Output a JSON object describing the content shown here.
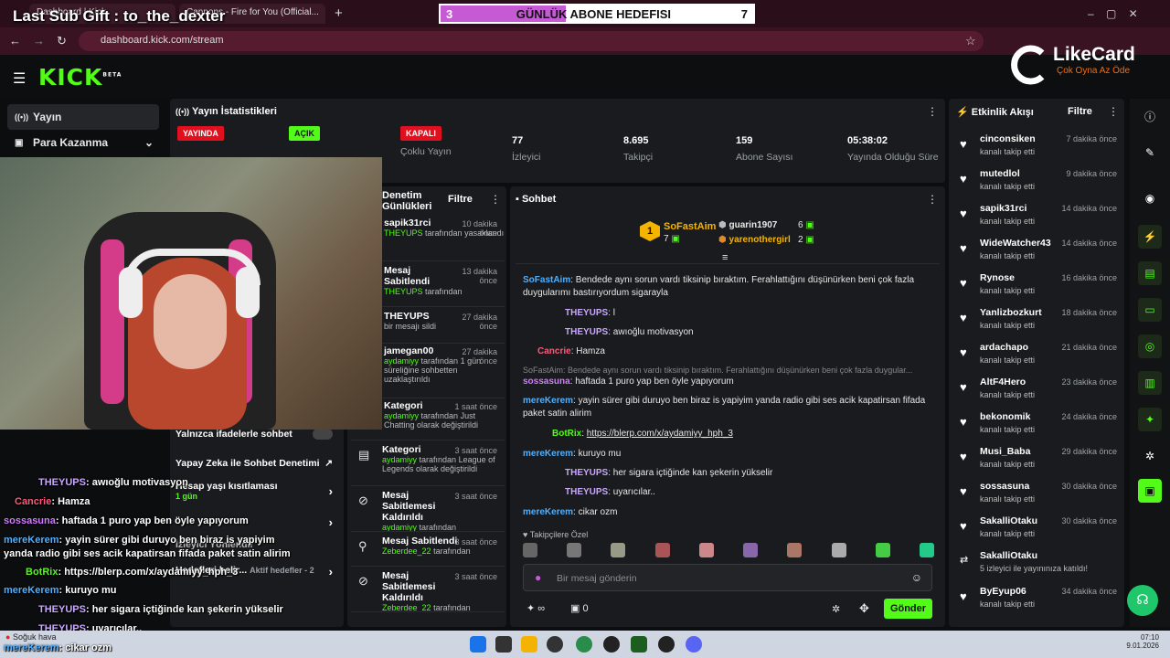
{
  "browser": {
    "tabs": [
      "Dashboard | Kick",
      "Kick Dashboard",
      "Cannons - Fire for You (Official..."
    ],
    "url": "dashboard.kick.com/stream"
  },
  "overlay": {
    "title": "Last Sub Gift : to_the_dexter",
    "goal": {
      "current": "3",
      "label": "GÜNLÜK ABONE HEDEFISI",
      "target": "7",
      "progress": 0.43
    }
  },
  "likecard": {
    "brand": "LikeCard",
    "tagline": "Çok Oyna  Az Öde"
  },
  "kick": {
    "logo": "KICK",
    "logo_sup": "BETA"
  },
  "left_nav": {
    "items": [
      {
        "label": "Yayın"
      },
      {
        "label": "Para Kazanma"
      }
    ]
  },
  "stats": {
    "title": "Yayın İstatistikleri",
    "live_badge": "YAYINDA",
    "open_badge": "AÇIK",
    "closed_badge": "KAPALI",
    "multi_stream": "Çoklu Yayın",
    "cells": [
      {
        "value": "77",
        "label": "İzleyici"
      },
      {
        "value": "8.695",
        "label": "Takipçi"
      },
      {
        "value": "159",
        "label": "Abone Sayısı"
      },
      {
        "value": "05:38:02",
        "label": "Yayında Olduğu Süre"
      }
    ]
  },
  "settings": {
    "rows": [
      {
        "label": "Yalnızca ifadelerle sohbet"
      },
      {
        "label": "Yapay Zeka ile Sohbet Denetimi"
      },
      {
        "label": "Hesap yaşı kısıtlaması",
        "sub": "1 gün"
      },
      {
        "label": "İzleyici Yönlendir"
      },
      {
        "label": "Hedefleri belir...",
        "sub": "Aktif hedefler - 2"
      }
    ]
  },
  "modlog": {
    "title": "Denetim Günlükleri",
    "filter": "Filtre",
    "items": [
      {
        "title": "sapik31rci",
        "time": "10 dakika önce",
        "by": "THEYUPS",
        "rest": "tarafından yasaklandı"
      },
      {
        "title": "Mesaj Sabitlendi",
        "time": "13 dakika önce",
        "by": "THEYUPS",
        "rest": "tarafından"
      },
      {
        "title": "THEYUPS",
        "time": "27 dakika önce",
        "by": "",
        "rest": "bir mesajı sildi"
      },
      {
        "title": "jamegan00",
        "time": "27 dakika önce",
        "by": "aydamiyy",
        "rest": "tarafından 1 gün süreliğine sohbetten uzaklaştırıldı"
      },
      {
        "title": "Kategori",
        "time": "1 saat önce",
        "by": "aydamiyy",
        "rest": "tarafından Just Chatting olarak değiştirildi"
      },
      {
        "title": "Kategori",
        "time": "3 saat önce",
        "by": "aydamiyy",
        "rest": "tarafından League of Legends olarak değiştirildi"
      },
      {
        "title": "Mesaj Sabitlemesi Kaldırıldı",
        "time": "3 saat önce",
        "by": "aydamiyy",
        "rest": "tarafından"
      },
      {
        "title": "Mesaj Sabitlendi",
        "time": "3 saat önce",
        "by": "Zeberdee_22",
        "rest": "tarafından"
      },
      {
        "title": "Mesaj Sabitlemesi Kaldırıldı",
        "time": "3 saat önce",
        "by": "Zeberdee_22",
        "rest": "tarafından"
      }
    ]
  },
  "chat": {
    "title": "Sohbet",
    "top_gifters": [
      {
        "rank": "1",
        "name": "SoFastAim",
        "count": "7"
      },
      {
        "rank": "2",
        "name": "guarin1907",
        "count": "6"
      },
      {
        "rank": "3",
        "name": "yarenothergirl",
        "count": "2"
      }
    ],
    "messages": [
      {
        "user": "SoFastAim",
        "color": "#4fb0ff",
        "text": "Bendede aynı sorun vardı tiksinip bıraktım. Ferahlattığını düşünürken beni çok fazla duygularımı bastırıyordum sigarayla"
      },
      {
        "user": "THEYUPS",
        "color": "#c9a6ff",
        "text": "l"
      },
      {
        "user": "THEYUPS",
        "color": "#c9a6ff",
        "text": "awıoğlu motivasyon"
      },
      {
        "user": "Cancrie",
        "color": "#ff5a7a",
        "text": "Hamza"
      },
      {
        "reply": "SoFastAim: Bendede aynı sorun vardı tiksinip bıraktım. Ferahlattığını düşünürken beni çok fazla duygular...",
        "user": "sossasuna",
        "color": "#d27cff",
        "text": "haftada 1 puro yap ben öyle yapıyorum"
      },
      {
        "user": "mereKerem",
        "color": "#4fb0ff",
        "text": "yayin sürer gibi duruyo ben biraz is yapiyim yanda radio gibi ses acik kapatirsan fifada paket satin alirim"
      },
      {
        "user": "BotRix",
        "color": "#53fc18",
        "text": "https://blerp.com/x/aydamiyy_hph_3"
      },
      {
        "user": "mereKerem",
        "color": "#4fb0ff",
        "text": "kuruyo mu"
      },
      {
        "user": "THEYUPS",
        "color": "#c9a6ff",
        "text": "her sigara içtiğinde kan şekerin yükselir"
      },
      {
        "user": "THEYUPS",
        "color": "#c9a6ff",
        "text": "uyarıcılar.."
      },
      {
        "user": "mereKerem",
        "color": "#4fb0ff",
        "text": "cikar ozm"
      }
    ],
    "followers_only": "Takipçilere Özel",
    "input_placeholder": "Bir mesaj gönderin",
    "points": "∞",
    "gifts": "0",
    "send": "Gönder"
  },
  "activity": {
    "title": "Etkinlik Akışı",
    "filter": "Filtre",
    "items": [
      {
        "name": "cinconsiken",
        "time": "7 dakika önce",
        "sub": "kanalı takip etti"
      },
      {
        "name": "mutedlol",
        "time": "9 dakika önce",
        "sub": "kanalı takip etti"
      },
      {
        "name": "sapik31rci",
        "time": "14 dakika önce",
        "sub": "kanalı takip etti"
      },
      {
        "name": "WideWatcher43",
        "time": "14 dakika önce",
        "sub": "kanalı takip etti"
      },
      {
        "name": "Rynose",
        "time": "16 dakika önce",
        "sub": "kanalı takip etti"
      },
      {
        "name": "Yanlizbozkurt",
        "time": "18 dakika önce",
        "sub": "kanalı takip etti"
      },
      {
        "name": "ardachapo",
        "time": "21 dakika önce",
        "sub": "kanalı takip etti"
      },
      {
        "name": "AltF4Hero",
        "time": "23 dakika önce",
        "sub": "kanalı takip etti"
      },
      {
        "name": "bekonomik",
        "time": "24 dakika önce",
        "sub": "kanalı takip etti"
      },
      {
        "name": "Musi_Baba",
        "time": "29 dakika önce",
        "sub": "kanalı takip etti"
      },
      {
        "name": "sossasuna",
        "time": "30 dakika önce",
        "sub": "kanalı takip etti"
      },
      {
        "name": "SakalliOtaku",
        "time": "30 dakika önce",
        "sub": "kanalı takip etti"
      },
      {
        "name": "SakalliOtaku",
        "time": "",
        "sub": "5 izleyici ile yayınınıza katıldı!"
      },
      {
        "name": "ByEyup06",
        "time": "34 dakika önce",
        "sub": "kanalı takip etti"
      }
    ]
  },
  "overlay_chat": [
    {
      "user": "THEYUPS",
      "color": "#c9a6ff",
      "text": "awıoğlu motivasyon"
    },
    {
      "user": "Cancrie",
      "color": "#ff5a7a",
      "text": "Hamza"
    },
    {
      "user": "sossasuna",
      "color": "#d27cff",
      "text": "haftada 1 puro yap ben öyle yapıyorum"
    },
    {
      "user": "mereKerem",
      "color": "#4fb0ff",
      "text": "yayin sürer gibi duruyo ben biraz is yapiyim"
    },
    {
      "user": "",
      "color": "#fff",
      "text": "yanda radio gibi ses acik kapatirsan fifada paket satin alirim"
    },
    {
      "user": "BotRix",
      "color": "#53fc18",
      "text": "https://blerp.com/x/aydamiyy_hph_3"
    },
    {
      "user": "mereKerem",
      "color": "#4fb0ff",
      "text": "kuruyo mu"
    },
    {
      "user": "THEYUPS",
      "color": "#c9a6ff",
      "text": "her sigara içtiğinde kan şekerin yükselir"
    },
    {
      "user": "THEYUPS",
      "color": "#c9a6ff",
      "text": "uyarıcılar.."
    },
    {
      "user": "mereKerem",
      "color": "#4fb0ff",
      "text": "cikar ozm"
    }
  ],
  "taskbar": {
    "weather": "Soğuk hava",
    "time": "07:10",
    "date": "9.01.2026"
  },
  "colors": {
    "accent": "#53fc18",
    "live": "#e0101f"
  }
}
